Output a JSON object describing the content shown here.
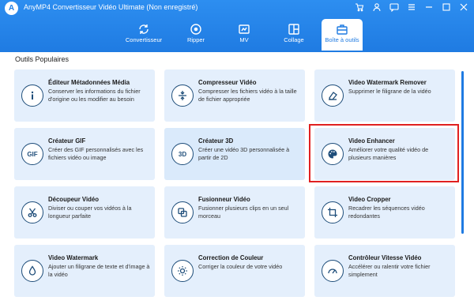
{
  "app": {
    "title": "AnyMP4 Convertisseur Vidéo Ultimate (Non enregistré)",
    "logo": "A"
  },
  "window_icons": [
    "cart-icon",
    "user-icon",
    "chat-icon",
    "menu-icon",
    "minimize-icon",
    "maximize-icon",
    "close-icon"
  ],
  "tabs": [
    {
      "label": "Convertisseur",
      "icon": "convert-icon",
      "active": false
    },
    {
      "label": "Ripper",
      "icon": "disc-icon",
      "active": false
    },
    {
      "label": "MV",
      "icon": "mv-icon",
      "active": false
    },
    {
      "label": "Collage",
      "icon": "collage-icon",
      "active": false
    },
    {
      "label": "Boîte à outils",
      "icon": "toolbox-icon",
      "active": true
    }
  ],
  "section_title": "Outils Populaires",
  "tools": [
    {
      "title": "Éditeur Métadonnées Média",
      "desc": "Conserver les informations du fichier d'origine ou les modifier au besoin",
      "icon": "i"
    },
    {
      "title": "Compresseur Vidéo",
      "desc": "Compresser les fichiers vidéo à la taille de fichier appropriée",
      "icon": "compress"
    },
    {
      "title": "Video Watermark Remover",
      "desc": "Supprimer le filigrane de la vidéo",
      "icon": "eraser"
    },
    {
      "title": "Créateur GIF",
      "desc": "Créer des GIF personnalisés avec les fichiers vidéo ou image",
      "icon": "GIF"
    },
    {
      "title": "Créateur 3D",
      "desc": "Créer une vidéo 3D personnalisée à partir de 2D",
      "icon": "3D"
    },
    {
      "title": "Video Enhancer",
      "desc": "Améliorer votre qualité vidéo de plusieurs manières",
      "icon": "palette"
    },
    {
      "title": "Découpeur Vidéo",
      "desc": "Diviser ou couper vos vidéos à la longueur parfaite",
      "icon": "scissors"
    },
    {
      "title": "Fusionneur Vidéo",
      "desc": "Fusionner plusieurs clips en un seul morceau",
      "icon": "merge"
    },
    {
      "title": "Video Cropper",
      "desc": "Recadrer les séquences vidéo redondantes",
      "icon": "crop"
    },
    {
      "title": "Video Watermark",
      "desc": "Ajouter un filigrane de texte et d'image à la vidéo",
      "icon": "drop"
    },
    {
      "title": "Correction de Couleur",
      "desc": "Corriger la couleur de votre vidéo",
      "icon": "sun"
    },
    {
      "title": "Contrôleur Vitesse Vidéo",
      "desc": "Accélérer ou ralentir votre fichier simplement",
      "icon": "speed"
    }
  ]
}
